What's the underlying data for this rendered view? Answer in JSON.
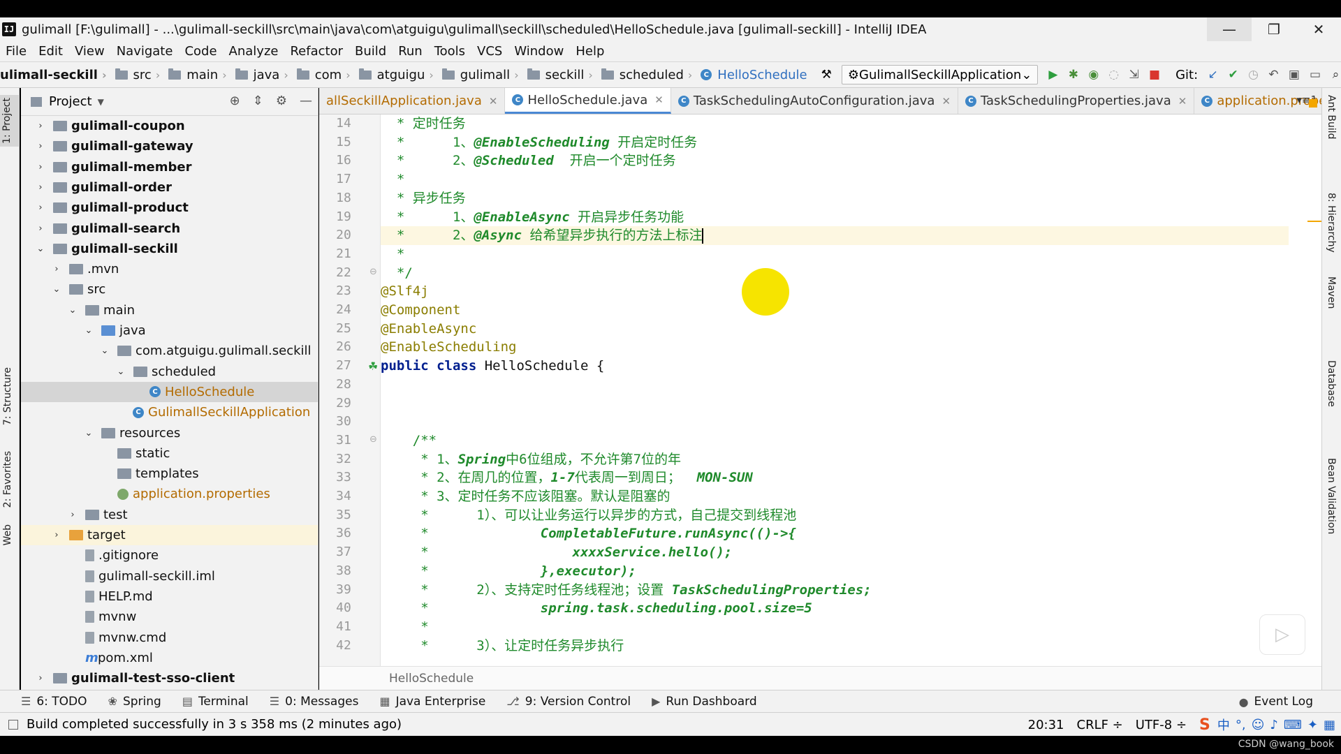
{
  "window": {
    "title": "gulimall [F:\\gulimall] - ...\\gulimall-seckill\\src\\main\\java\\com\\atguigu\\gulimall\\seckill\\scheduled\\HelloSchedule.java [gulimall-seckill] - IntelliJ IDEA",
    "app_icon": "IJ"
  },
  "menu": [
    "File",
    "Edit",
    "View",
    "Navigate",
    "Code",
    "Analyze",
    "Refactor",
    "Build",
    "Run",
    "Tools",
    "VCS",
    "Window",
    "Help"
  ],
  "breadcrumb": [
    "ulimall-seckill",
    "src",
    "main",
    "java",
    "com",
    "atguigu",
    "gulimall",
    "seckill",
    "scheduled",
    "HelloSchedule"
  ],
  "run_config": "GulimallSeckillApplication",
  "git_label": "Git:",
  "project_panel": {
    "title": "Project",
    "tree": [
      {
        "label": "gulimall-coupon",
        "depth": 0,
        "arrow": "›",
        "icon": "mod",
        "bold": true
      },
      {
        "label": "gulimall-gateway",
        "depth": 0,
        "arrow": "›",
        "icon": "mod",
        "bold": true
      },
      {
        "label": "gulimall-member",
        "depth": 0,
        "arrow": "›",
        "icon": "mod",
        "bold": true
      },
      {
        "label": "gulimall-order",
        "depth": 0,
        "arrow": "›",
        "icon": "mod",
        "bold": true
      },
      {
        "label": "gulimall-product",
        "depth": 0,
        "arrow": "›",
        "icon": "mod",
        "bold": true
      },
      {
        "label": "gulimall-search",
        "depth": 0,
        "arrow": "›",
        "icon": "mod",
        "bold": true
      },
      {
        "label": "gulimall-seckill",
        "depth": 0,
        "arrow": "⌄",
        "icon": "mod",
        "bold": true
      },
      {
        "label": ".mvn",
        "depth": 1,
        "arrow": "›",
        "icon": "gray"
      },
      {
        "label": "src",
        "depth": 1,
        "arrow": "⌄",
        "icon": "gray"
      },
      {
        "label": "main",
        "depth": 2,
        "arrow": "⌄",
        "icon": "gray"
      },
      {
        "label": "java",
        "depth": 3,
        "arrow": "⌄",
        "icon": "blue"
      },
      {
        "label": "com.atguigu.gulimall.seckill",
        "depth": 4,
        "arrow": "⌄",
        "icon": "gray"
      },
      {
        "label": "scheduled",
        "depth": 5,
        "arrow": "⌄",
        "icon": "gray"
      },
      {
        "label": "HelloSchedule",
        "depth": 6,
        "arrow": "",
        "icon": "class",
        "color": "orange",
        "selected": true
      },
      {
        "label": "GulimallSeckillApplication",
        "depth": 6,
        "arrow": "",
        "icon": "class",
        "color": "orange",
        "offset": -1
      },
      {
        "label": "resources",
        "depth": 3,
        "arrow": "⌄",
        "icon": "gray"
      },
      {
        "label": "static",
        "depth": 4,
        "arrow": "",
        "icon": "gray"
      },
      {
        "label": "templates",
        "depth": 4,
        "arrow": "",
        "icon": "gray"
      },
      {
        "label": "application.properties",
        "depth": 4,
        "arrow": "",
        "icon": "prop",
        "color": "orange"
      },
      {
        "label": "test",
        "depth": 2,
        "arrow": "›",
        "icon": "gray"
      },
      {
        "label": "target",
        "depth": 1,
        "arrow": "›",
        "icon": "orange",
        "highlight": true
      },
      {
        "label": ".gitignore",
        "depth": 2,
        "arrow": "",
        "icon": "file"
      },
      {
        "label": "gulimall-seckill.iml",
        "depth": 2,
        "arrow": "",
        "icon": "file"
      },
      {
        "label": "HELP.md",
        "depth": 2,
        "arrow": "",
        "icon": "file"
      },
      {
        "label": "mvnw",
        "depth": 2,
        "arrow": "",
        "icon": "file"
      },
      {
        "label": "mvnw.cmd",
        "depth": 2,
        "arrow": "",
        "icon": "file"
      },
      {
        "label": "pom.xml",
        "depth": 2,
        "arrow": "",
        "icon": "xml"
      },
      {
        "label": "gulimall-test-sso-client",
        "depth": 0,
        "arrow": "›",
        "icon": "mod",
        "bold": true
      }
    ]
  },
  "editor_tabs": [
    {
      "label": "allSeckillApplication.java",
      "active": false,
      "color": "orange"
    },
    {
      "label": "HelloSchedule.java",
      "active": true
    },
    {
      "label": "TaskSchedulingAutoConfiguration.java",
      "active": false
    },
    {
      "label": "TaskSchedulingProperties.java",
      "active": false
    },
    {
      "label": "application.properties",
      "active": false,
      "color": "orange"
    }
  ],
  "code_lines": [
    {
      "n": "14",
      "spans": [
        [
          "cmt",
          "  * 定时任务"
        ]
      ]
    },
    {
      "n": "15",
      "spans": [
        [
          "cmt",
          "  *      1、"
        ],
        [
          "cmti",
          "@EnableScheduling"
        ],
        [
          "cmt",
          " 开启定时任务"
        ]
      ]
    },
    {
      "n": "16",
      "spans": [
        [
          "cmt",
          "  *      2、"
        ],
        [
          "cmti",
          "@Scheduled"
        ],
        [
          "cmt",
          "  开启一个定时任务"
        ]
      ]
    },
    {
      "n": "17",
      "spans": [
        [
          "cmt",
          "  *"
        ]
      ]
    },
    {
      "n": "18",
      "spans": [
        [
          "cmt",
          "  * 异步任务"
        ]
      ]
    },
    {
      "n": "19",
      "spans": [
        [
          "cmt",
          "  *      1、"
        ],
        [
          "cmti",
          "@EnableAsync"
        ],
        [
          "cmt",
          " 开启异步任务功能"
        ]
      ]
    },
    {
      "n": "20",
      "spans": [
        [
          "cmt",
          "  *      2、"
        ],
        [
          "cmti",
          "@Async"
        ],
        [
          "cmt",
          " 给希望异步执行的方法上标注"
        ]
      ],
      "current": true
    },
    {
      "n": "21",
      "spans": [
        [
          "cmt",
          "  *"
        ]
      ]
    },
    {
      "n": "22",
      "spans": [
        [
          "cmt",
          "  */"
        ]
      ]
    },
    {
      "n": "23",
      "spans": [
        [
          "ann",
          "@Slf4j"
        ]
      ]
    },
    {
      "n": "24",
      "spans": [
        [
          "ann",
          "@Component"
        ]
      ]
    },
    {
      "n": "25",
      "spans": [
        [
          "ann",
          "@EnableAsync"
        ]
      ]
    },
    {
      "n": "26",
      "spans": [
        [
          "ann",
          "@EnableScheduling"
        ]
      ]
    },
    {
      "n": "27",
      "spans": [
        [
          "kw",
          "public class "
        ],
        [
          "plain",
          "HelloSchedule {"
        ]
      ]
    },
    {
      "n": "28",
      "spans": []
    },
    {
      "n": "29",
      "spans": []
    },
    {
      "n": "30",
      "spans": []
    },
    {
      "n": "31",
      "spans": [
        [
          "cmt",
          "    /**"
        ]
      ]
    },
    {
      "n": "32",
      "spans": [
        [
          "cmt",
          "     * 1、"
        ],
        [
          "cmti",
          "Spring"
        ],
        [
          "cmt",
          "中6位组成，不允许第7位的年"
        ]
      ]
    },
    {
      "n": "33",
      "spans": [
        [
          "cmt",
          "     * 2、在周几的位置，"
        ],
        [
          "cmti",
          "1-7"
        ],
        [
          "cmt",
          "代表周一到周日；  "
        ],
        [
          "cmti",
          "MON-SUN"
        ]
      ]
    },
    {
      "n": "34",
      "spans": [
        [
          "cmt",
          "     * 3、定时任务不应该阻塞。默认是阻塞的"
        ]
      ]
    },
    {
      "n": "35",
      "spans": [
        [
          "cmt",
          "     *      1）、可以让业务运行以异步的方式，自己提交到线程池"
        ]
      ]
    },
    {
      "n": "36",
      "spans": [
        [
          "cmt",
          "     *              "
        ],
        [
          "cmti",
          "CompletableFuture.runAsync(()->{"
        ]
      ]
    },
    {
      "n": "37",
      "spans": [
        [
          "cmt",
          "     *                  "
        ],
        [
          "cmti",
          "xxxxService.hello();"
        ]
      ]
    },
    {
      "n": "38",
      "spans": [
        [
          "cmt",
          "     *              "
        ],
        [
          "cmti",
          "},executor);"
        ]
      ]
    },
    {
      "n": "39",
      "spans": [
        [
          "cmt",
          "     *      2）、支持定时任务线程池；设置 "
        ],
        [
          "cmti",
          "TaskSchedulingProperties;"
        ]
      ]
    },
    {
      "n": "40",
      "spans": [
        [
          "cmt",
          "     *              "
        ],
        [
          "cmti",
          "spring.task.scheduling.pool.size=5"
        ]
      ]
    },
    {
      "n": "41",
      "spans": [
        [
          "cmt",
          "     *"
        ]
      ]
    },
    {
      "n": "42",
      "spans": [
        [
          "cmt",
          "     *      3）、让定时任务异步执行"
        ]
      ]
    }
  ],
  "editor_breadcrumb": "HelloSchedule",
  "left_tool_tabs": [
    "1: Project",
    "7: Structure",
    "2: Favorites",
    "Web"
  ],
  "right_tool_tabs": [
    "Ant Build",
    "8: Hierarchy",
    "Maven",
    "Database",
    "Bean Validation"
  ],
  "tool_windows": [
    "6: TODO",
    "Spring",
    "Terminal",
    "0: Messages",
    "Java Enterprise",
    "9: Version Control",
    "Run Dashboard"
  ],
  "event_log": "Event Log",
  "status": {
    "message": "Build completed successfully in 3 s 358 ms (2 minutes ago)",
    "position": "20:31",
    "line_sep": "CRLF ÷",
    "encoding": "UTF-8 ÷"
  },
  "watermark": "CSDN @wang_book"
}
